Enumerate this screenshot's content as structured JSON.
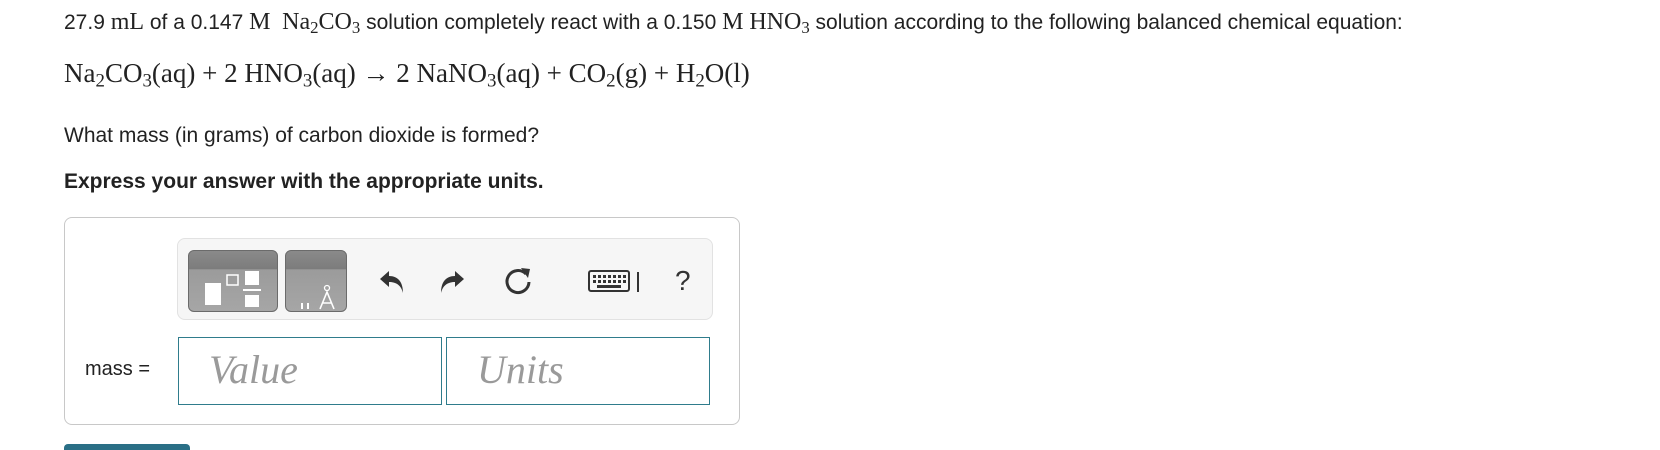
{
  "problem": {
    "volume": "27.9",
    "volume_unit": "mL",
    "text_a": " of a 0.147 ",
    "molarity_unit_1": "M",
    "reactant_1": "Na",
    "reactant_1_sub_a": "2",
    "reactant_1_b": "CO",
    "reactant_1_sub_b": "3",
    "text_b": " solution completely react with a 0.150 ",
    "molarity_unit_2": "M",
    "reactant_2": "HNO",
    "reactant_2_sub": "3",
    "text_c": " solution according to the following balanced chemical equation:"
  },
  "equation": {
    "t1": "Na",
    "s1": "2",
    "t2": "CO",
    "s2": "3",
    "t3": "(aq) + 2 HNO",
    "s3": "3",
    "t4": "(aq) → 2 NaNO",
    "s4": "3",
    "t5": "(aq) + CO",
    "s5": "2",
    "t6": "(g) + H",
    "s6": "2",
    "t7": "O(l)"
  },
  "question": "What mass (in grams) of carbon dioxide is formed?",
  "instruction": "Express your answer with the appropriate units.",
  "answer": {
    "label": "mass =",
    "value_placeholder": "Value",
    "units_placeholder": "Units",
    "help_label": "?"
  },
  "toolbar": {
    "icons": [
      "templates-icon",
      "units-icon",
      "undo-icon",
      "redo-icon",
      "reset-icon",
      "keyboard-icon"
    ]
  }
}
